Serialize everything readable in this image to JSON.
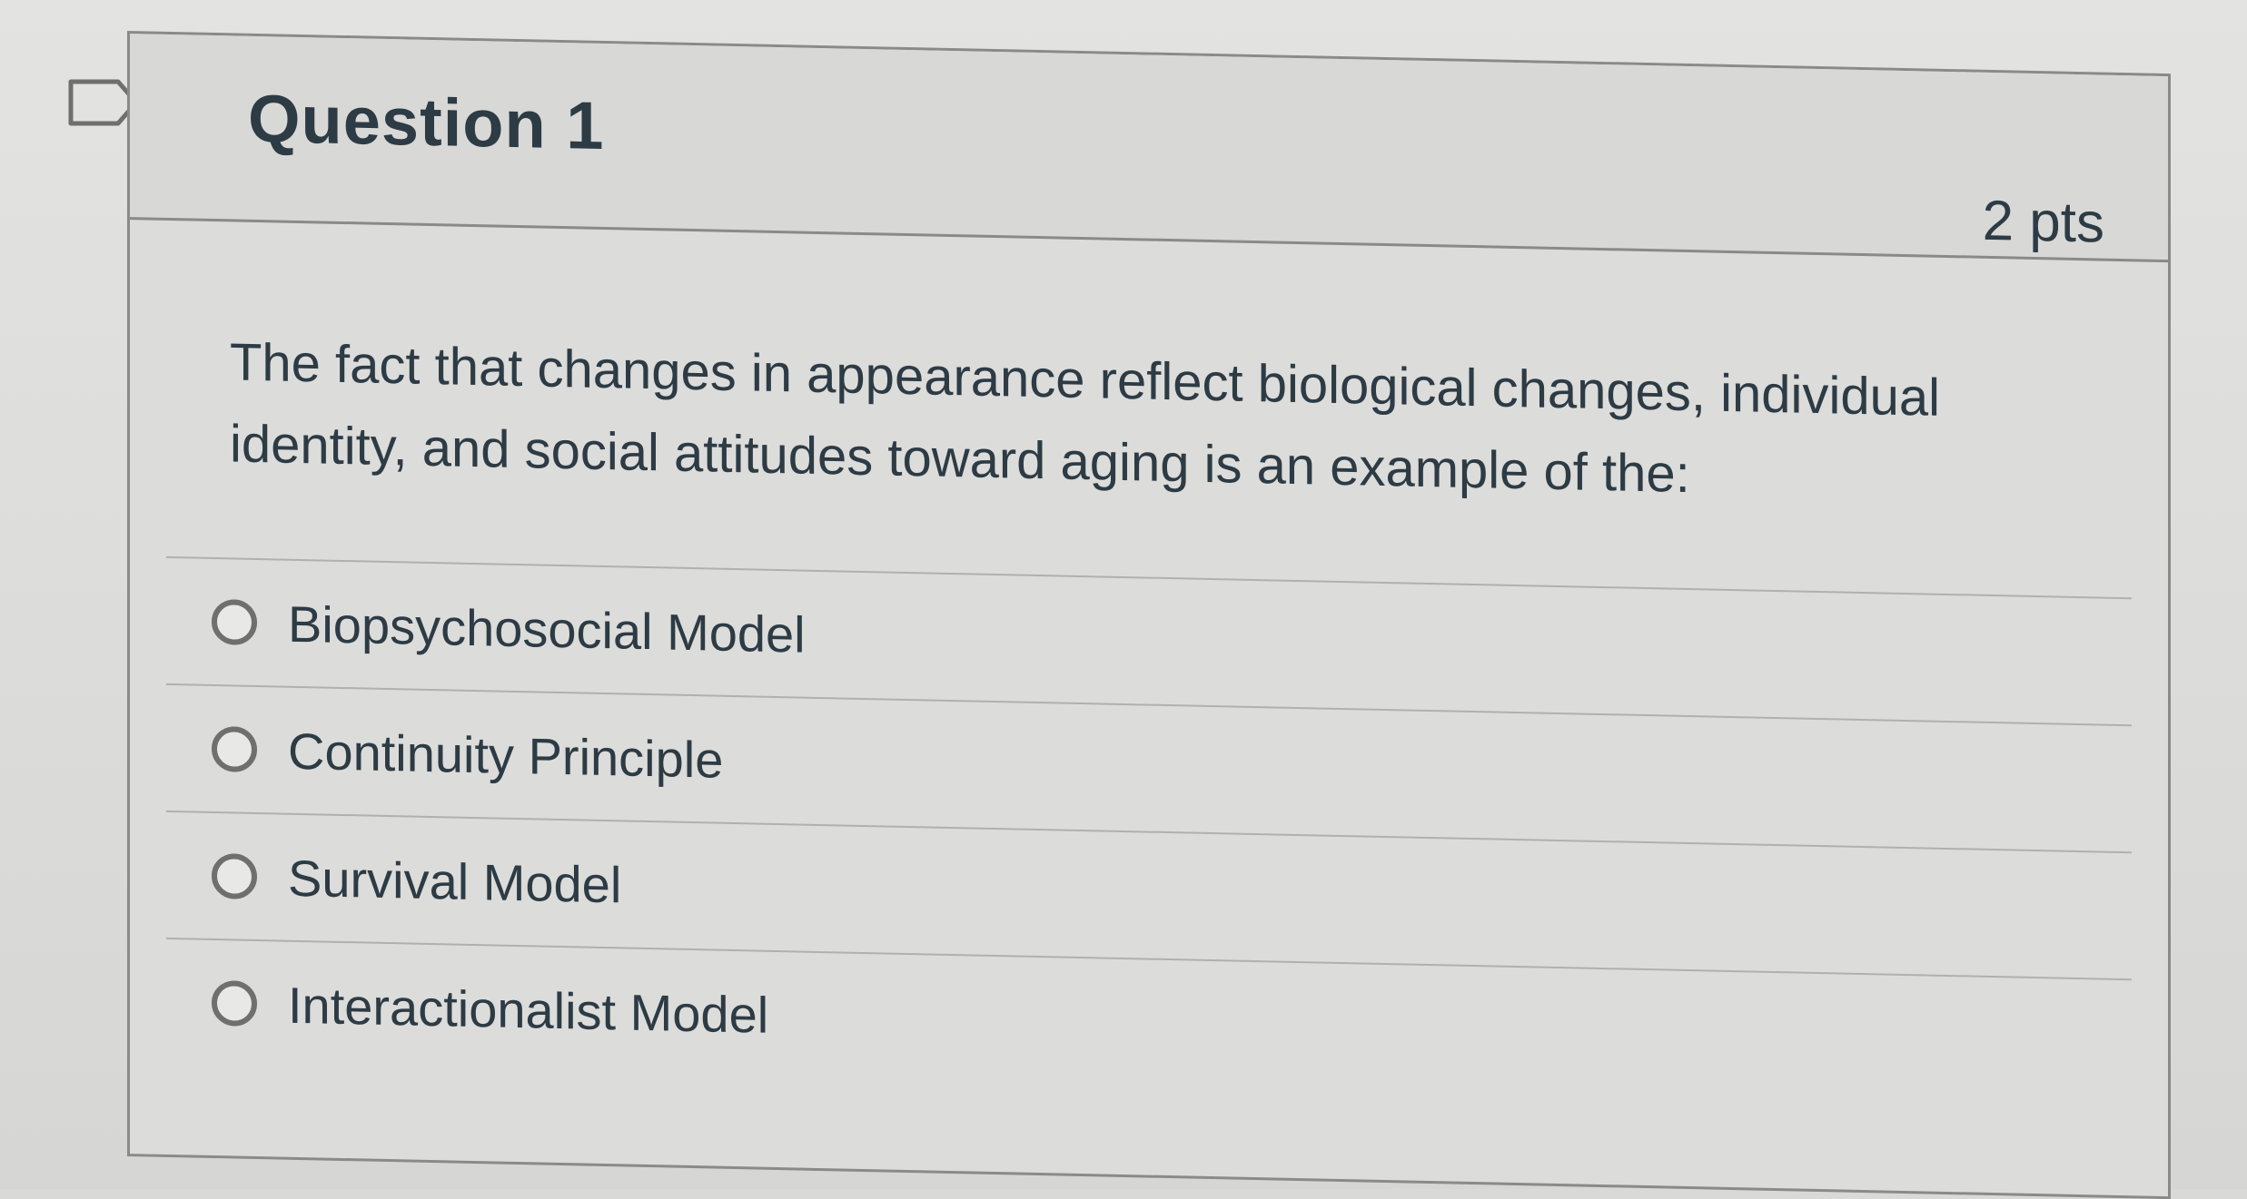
{
  "question": {
    "title": "Question 1",
    "points": "2 pts",
    "text": "The fact that changes in appearance reflect biological changes, individual identity, and social attitudes toward aging is an example of the:",
    "flag_icon": "bookmark-flag-icon"
  },
  "answers": [
    {
      "label": "Biopsychosocial Model",
      "icon": "radio-unselected-icon"
    },
    {
      "label": "Continuity Principle",
      "icon": "radio-unselected-icon"
    },
    {
      "label": "Survival Model",
      "icon": "radio-unselected-icon"
    },
    {
      "label": "Interactionalist Model",
      "icon": "radio-unselected-icon"
    }
  ],
  "colors": {
    "text": "#2d3b45",
    "border": "#8a8a88",
    "radio": "#6f6f6d"
  }
}
